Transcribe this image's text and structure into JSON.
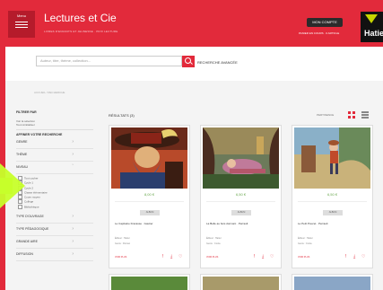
{
  "header": {
    "menu_label": "Menu",
    "site_title": "Lectures et Cie",
    "tagline": "LIVRES D'ENFANTS ET JEUNESSE · PRIX LECTURE",
    "account_label": "MON COMPTE",
    "basket_label": "PANIER EN COURS · 0 ARTICLE",
    "brand_word": "Hatier"
  },
  "search": {
    "placeholder": "Auteur, titre, thème, collection...",
    "advanced_label": "RECHERCHE AVANCÉE"
  },
  "breadcrumb": "ACCUEIL / RECHERCHE",
  "sidebar": {
    "section_title": "FILTRER PAR",
    "reset_link": "Voir la sélection",
    "reset_link2": "Tout réinitialiser",
    "active_title": "AFFINER VOTRE RECHERCHE",
    "rows": [
      "GENRE",
      "THÈME",
      "NIVEAU",
      "TYPE D'OUVRAGE",
      "TYPE PÉDAGOGIQUE",
      "GRANDE AIRE",
      "DIFFUSION"
    ],
    "checks": [
      "Tout cocher",
      "Cycle 1",
      "Cycle 2",
      "Classe élémentaire",
      "Cours moyen",
      "Collège",
      "Bibliothèque"
    ]
  },
  "results": {
    "title": "RÉSULTATS (3)",
    "sort_label": "PERTINENCE"
  },
  "cards": [
    {
      "price": "8,00 €",
      "tag": "ALBUM",
      "title": "Le Capitaine Fracasse · Gautier",
      "meta1": "Éditeur : Hatier",
      "meta2": "Genre : Roman",
      "more": "VOIR PLUS"
    },
    {
      "price": "6,50 €",
      "tag": "ALBUM",
      "title": "La Belle au bois dormant · Perrault",
      "meta1": "Éditeur : Hatier",
      "meta2": "Genre : Conte",
      "more": "VOIR PLUS"
    },
    {
      "price": "6,50 €",
      "tag": "ALBUM",
      "title": "Le Petit Poucet · Perrault",
      "meta1": "Éditeur : Hatier",
      "meta2": "Genre : Conte",
      "more": "VOIR PLUS"
    }
  ],
  "colors": {
    "brand_red": "#e22a3b",
    "dark": "#2b2b2b",
    "accent_green": "#c7ff2a",
    "price_green": "#6aa84f"
  }
}
